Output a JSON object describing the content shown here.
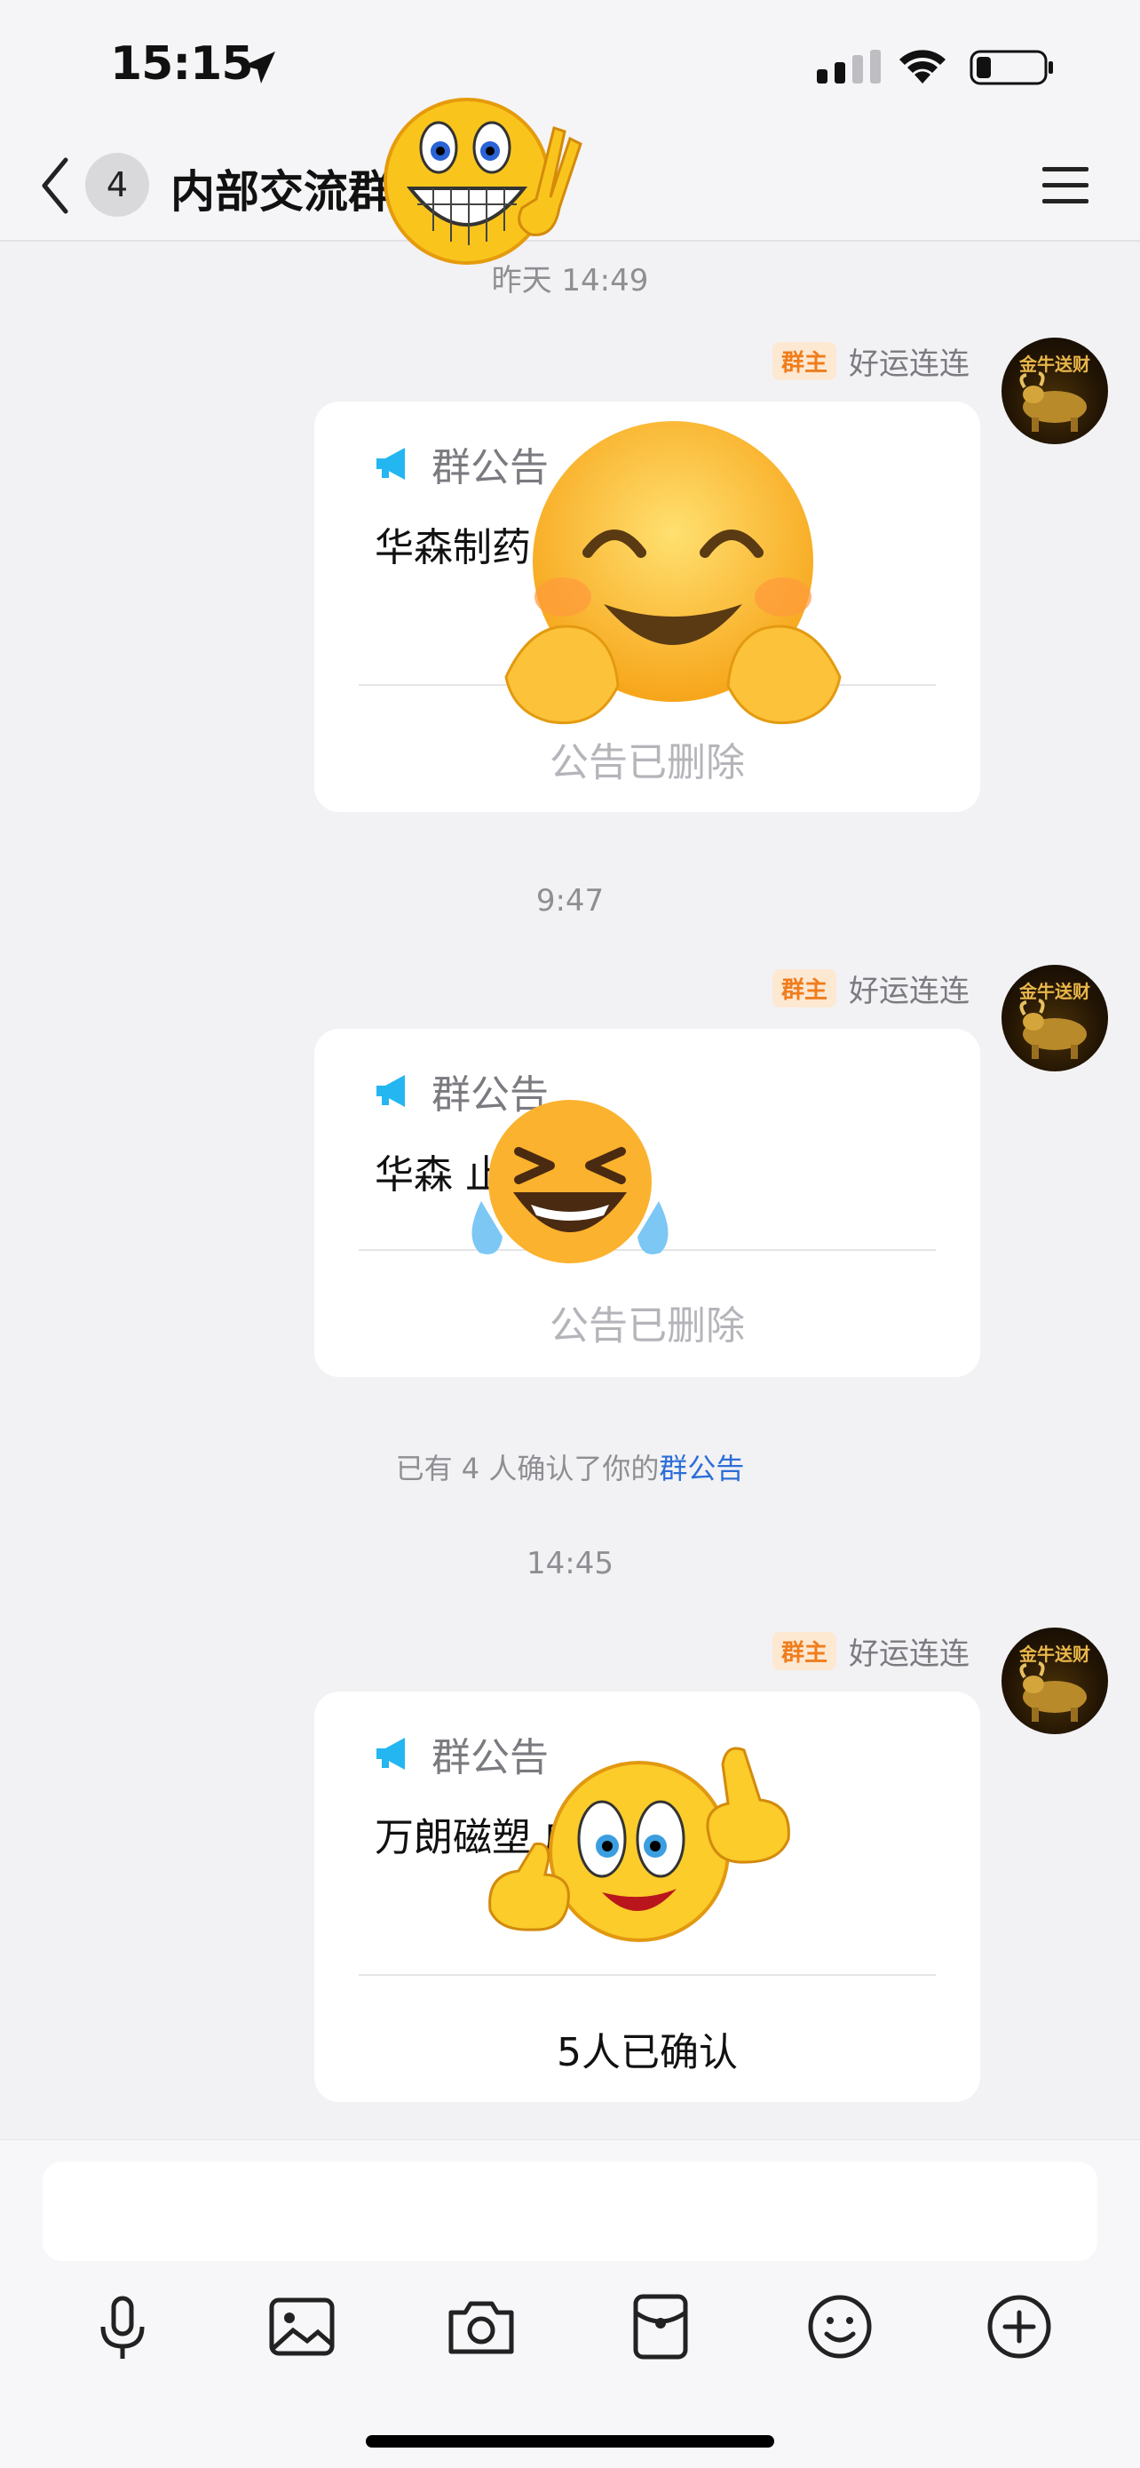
{
  "status_bar": {
    "time": "15:15",
    "icons": [
      "location-arrow-icon",
      "cellular-signal-icon",
      "wifi-icon",
      "battery-icon"
    ]
  },
  "nav": {
    "back_icon": "chevron-left-icon",
    "unread_count": "4",
    "title": "内部交流群",
    "menu_icon": "hamburger-menu-icon"
  },
  "messages": [
    {
      "timestamp": "昨天 14:49",
      "role_badge": "群主",
      "sender": "好运连连",
      "avatar_text": "金牛送财",
      "card_title": "群公告",
      "card_body": "华森制药                  成仓操作",
      "card_footer": "公告已删除"
    },
    {
      "timestamp": "9:47",
      "role_badge": "群主",
      "sender": "好运连连",
      "avatar_text": "金牛送财",
      "card_title": "群公告",
      "card_body": "华森              止损了。",
      "card_footer": "公告已删除"
    },
    {
      "notice_prefix": "已有 4 人确认了你的",
      "notice_link": "群公告"
    },
    {
      "timestamp": "14:45",
      "role_badge": "群主",
      "sender": "好运连连",
      "avatar_text": "金牛送财",
      "card_title": "群公告",
      "card_body": "万朗磁塑            成仓操作。",
      "card_footer": "5人已确认"
    }
  ],
  "input": {
    "placeholder": ""
  },
  "toolbar": [
    "microphone-icon",
    "image-icon",
    "camera-icon",
    "red-packet-icon",
    "emoji-icon",
    "plus-icon"
  ],
  "colors": {
    "background": "#f2f2f4",
    "badge_bg": "#fde8d2",
    "badge_text": "#f07d1c",
    "link": "#2d6ed8",
    "megaphone": "#23b6f0"
  }
}
